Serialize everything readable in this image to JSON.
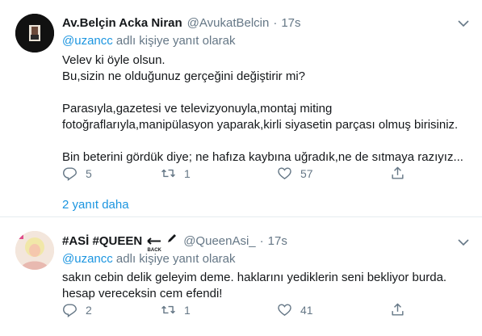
{
  "tweets": [
    {
      "name": "Av.Belçin Acka Niran",
      "handle": "@AvukatBelcin",
      "separator": "·",
      "time": "17s",
      "reply_mention": "@uzancc",
      "reply_suffix": " adlı kişiye yanıt olarak",
      "lines": [
        "Velev ki öyle olsun.",
        "Bu,sizin ne olduğunuz gerçeğini değiştirir mi?",
        "",
        "Parasıyla,gazetesi ve televizyonuyla,montaj miting",
        "fotoğraflarıyla,manipülasyon yaparak,kirli siyasetin parçası olmuş birisiniz.",
        "",
        "Bin beterini gördük diye; ne hafıza kaybına uğradık,ne de sıtmaya razıyız..."
      ],
      "replies": "5",
      "retweets": "1",
      "likes": "57",
      "more_replies": "2 yanıt daha"
    },
    {
      "name": "#ASİ #QUEEN",
      "badge_text": "BACK",
      "handle": "@QueenAsi_",
      "separator": "·",
      "time": "17s",
      "reply_mention": "@uzancc",
      "reply_suffix": " adlı kişiye yanıt olarak",
      "lines": [
        "sakın cebin delik geleyim deme. haklarını yediklerin seni bekliyor burda.",
        "hesap vereceksin cem efendi!"
      ],
      "replies": "2",
      "retweets": "1",
      "likes": "41"
    }
  ],
  "colors": {
    "text": "#14171a",
    "muted": "#657786",
    "link": "#1b95e0",
    "divider": "#e6ecf0"
  },
  "icons": [
    "reply-icon",
    "retweet-icon",
    "like-icon",
    "share-icon",
    "chevron-down-icon",
    "back-arrow-icon",
    "pencil-icon"
  ]
}
